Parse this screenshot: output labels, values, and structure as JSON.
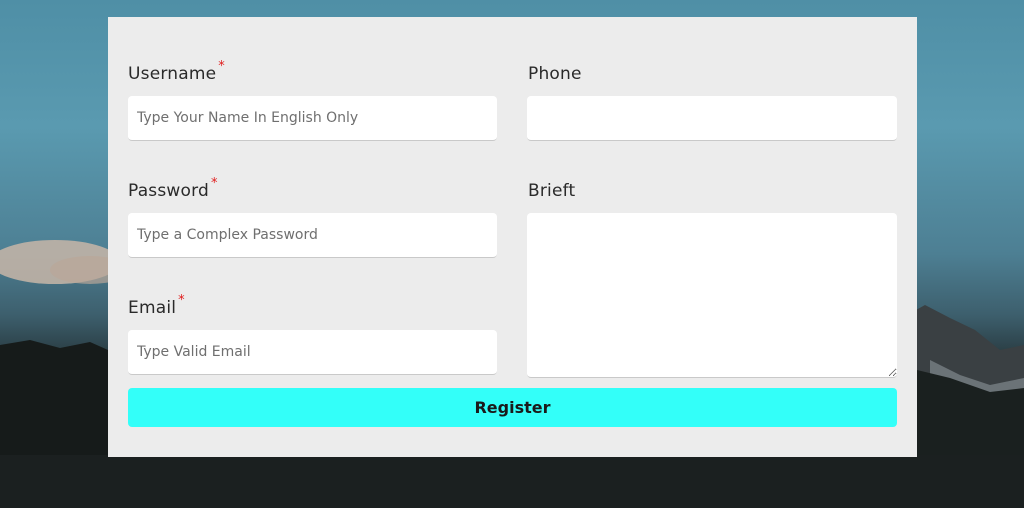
{
  "form": {
    "username": {
      "label": "Username",
      "required_mark": "*",
      "placeholder": "Type Your Name In English Only",
      "value": ""
    },
    "password": {
      "label": "Password",
      "required_mark": "*",
      "placeholder": "Type a Complex Password",
      "value": ""
    },
    "email": {
      "label": "Email",
      "required_mark": "*",
      "placeholder": "Type Valid Email",
      "value": ""
    },
    "phone": {
      "label": "Phone",
      "placeholder": "",
      "value": ""
    },
    "brief": {
      "label": "Brieft",
      "placeholder": "",
      "value": ""
    },
    "register_label": "Register"
  },
  "colors": {
    "button": "#33fff9",
    "required": "#e01b1b",
    "card": "#ececec"
  }
}
